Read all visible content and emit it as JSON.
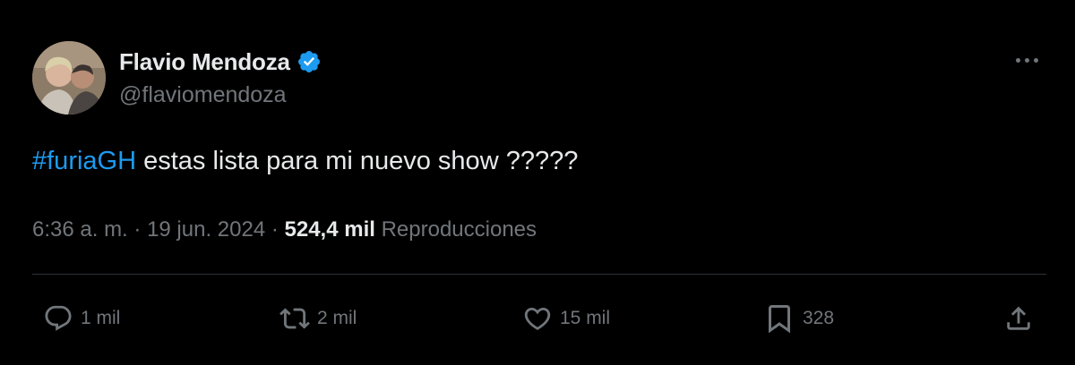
{
  "tweet": {
    "author": {
      "display_name": "Flavio Mendoza",
      "handle": "@flaviomendoza",
      "verified": true
    },
    "text": {
      "hashtag": "#furiaGH",
      "body": " estas lista para mi nuevo show ?????"
    },
    "meta": {
      "time": "6:36 a. m.",
      "separator": " · ",
      "date": "19 jun. 2024",
      "views_count": "524,4 mil",
      "views_label": " Reproducciones"
    },
    "actions": {
      "reply_count": "1 mil",
      "repost_count": "2 mil",
      "like_count": "15 mil",
      "bookmark_count": "328"
    }
  },
  "colors": {
    "background": "#000000",
    "text": "#e7e9ea",
    "secondary": "#71767b",
    "accent": "#1d9bf0",
    "divider": "#2f3336"
  },
  "icons": {
    "verified": "verified-badge-icon",
    "more": "more-dots-icon",
    "reply": "reply-icon",
    "repost": "repost-icon",
    "like": "heart-icon",
    "bookmark": "bookmark-icon",
    "share": "share-icon"
  }
}
